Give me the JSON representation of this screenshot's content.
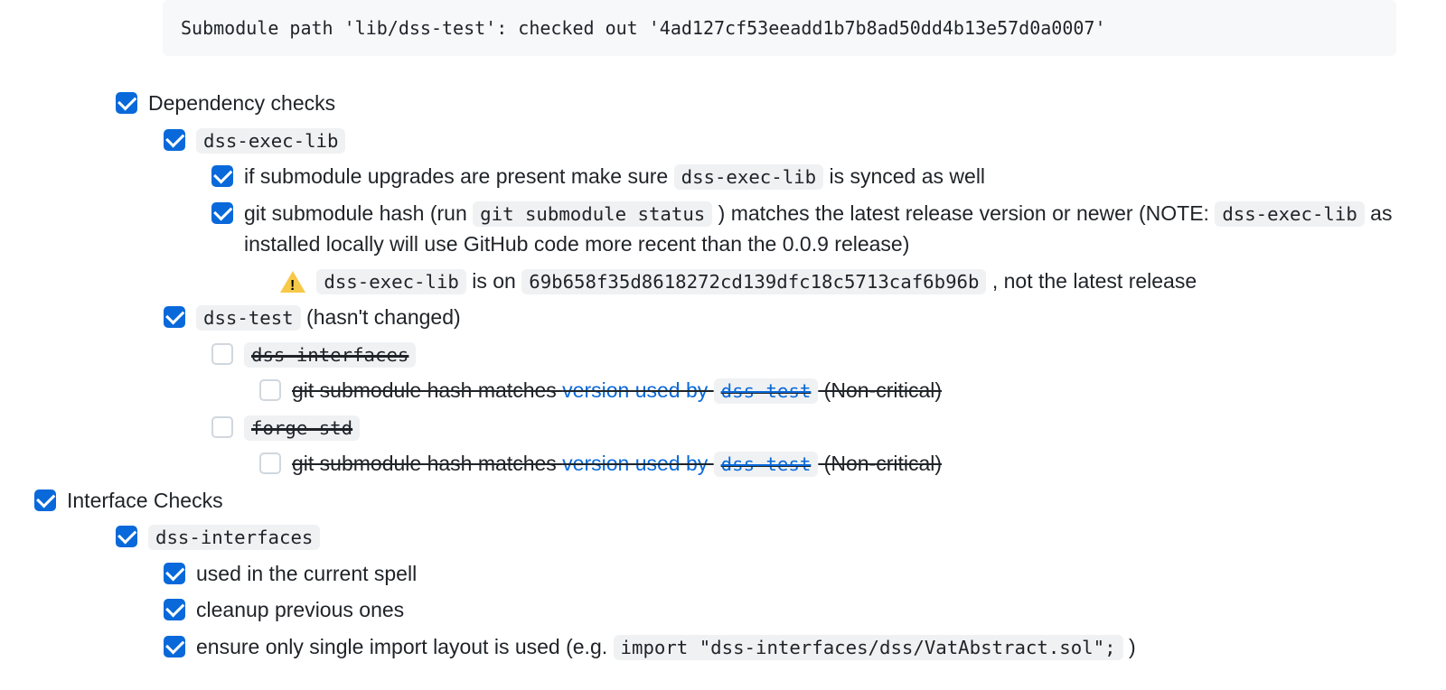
{
  "codeblock": "Submodule path 'lib/dss-test': checked out '4ad127cf53eeadd1b7b8ad50dd4b13e57d0a0007'",
  "items": {
    "dep_checks": "Dependency checks",
    "dss_exec_lib": "dss-exec-lib",
    "submodule_upgrades_pre": "if submodule upgrades are present make sure ",
    "submodule_upgrades_code": "dss-exec-lib",
    "submodule_upgrades_post": " is synced as well",
    "git_hash_pre": "git submodule hash (run ",
    "git_hash_code1": "git submodule status",
    "git_hash_mid": " ) matches the latest release version or newer (NOTE: ",
    "git_hash_code2": "dss-exec-lib",
    "git_hash_post": " as installed locally will use GitHub code more recent than the 0.0.9 release)",
    "warn_pre": " ",
    "warn_code1": "dss-exec-lib",
    "warn_mid": " is on ",
    "warn_code2": "69b658f35d8618272cd139dfc18c5713caf6b96b",
    "warn_post": " , not the latest release",
    "dss_test_code": "dss-test",
    "dss_test_post": " (hasn't changed)",
    "dss_interfaces": "dss-interfaces",
    "hash_matches_pre": "git submodule hash matches ",
    "hash_matches_link": "version used by ",
    "hash_matches_code": "dss-test",
    "hash_matches_post": " (Non-critical)",
    "forge_std": "forge-std",
    "iface_checks": "Interface Checks",
    "iface_dss_interfaces": "dss-interfaces",
    "iface_used": "used in the current spell",
    "iface_cleanup": "cleanup previous ones",
    "iface_ensure_pre": "ensure only single import layout is used (e.g. ",
    "iface_ensure_code": "import \"dss-interfaces/dss/VatAbstract.sol\";",
    "iface_ensure_post": " )"
  }
}
